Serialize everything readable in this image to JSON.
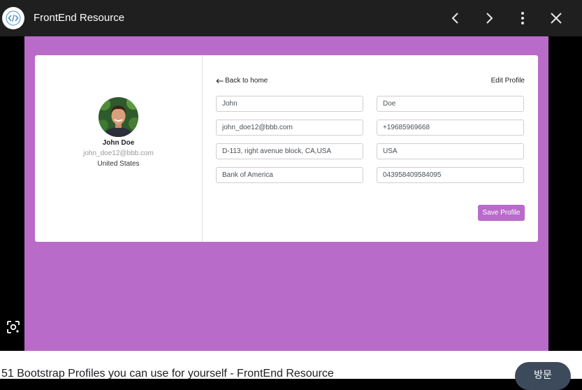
{
  "header": {
    "site_name": "FrontEnd Resource",
    "logo_icon": "code-brackets-icon",
    "actions": [
      "chevron-left-icon",
      "chevron-right-icon",
      "more-vert-icon",
      "close-icon"
    ]
  },
  "profile": {
    "name": "John Doe",
    "email": "john_doe12@bbb.com",
    "country": "United States",
    "avatar_icon": "user-photo"
  },
  "form": {
    "back_label": "Back to home",
    "title": "Edit Profile",
    "first_name": "John",
    "last_name": "Doe",
    "email": "john_doe12@bbb.com",
    "phone": "+19685969668",
    "address": "D-113, right avenue block, CA,USA",
    "country": "USA",
    "bank": "Bank of America",
    "account": "043958409584095",
    "save_label": "Save Profile"
  },
  "footer": {
    "caption": "51 Bootstrap Profiles you can use for yourself - FrontEnd Resource",
    "visit_label": "방문"
  },
  "colors": {
    "accent": "#b96bc9",
    "topbar": "#1f1f1f"
  }
}
